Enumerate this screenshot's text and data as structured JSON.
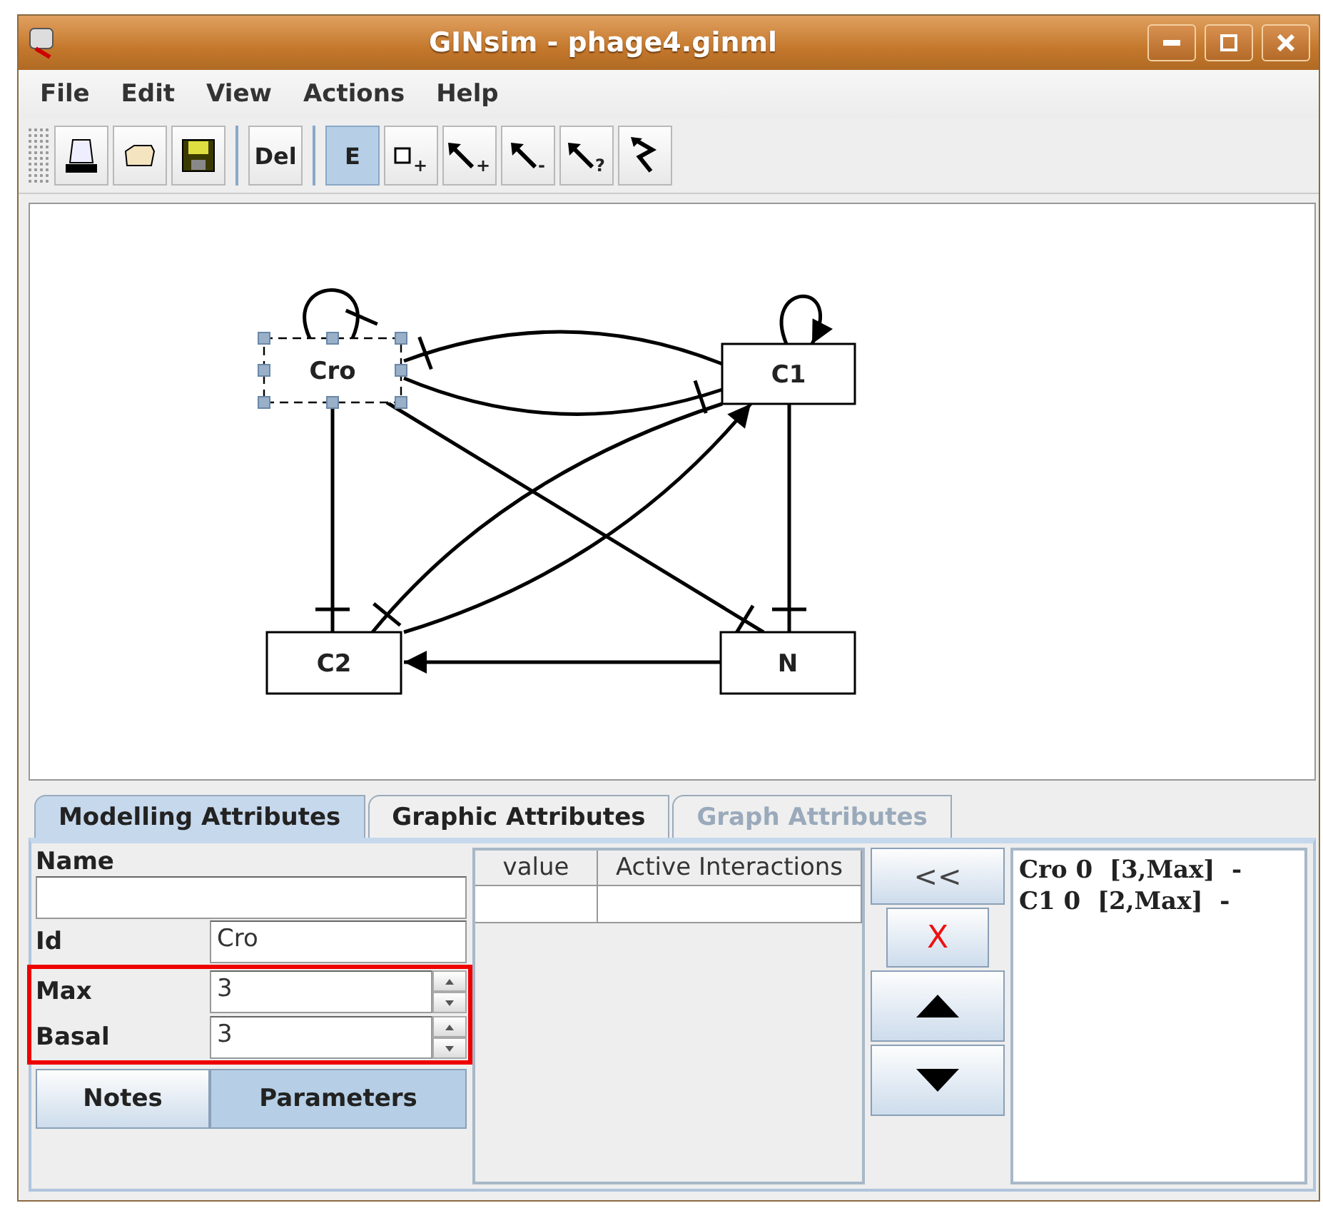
{
  "window": {
    "title": "GINsim - phage4.ginml"
  },
  "menu": [
    "File",
    "Edit",
    "View",
    "Actions",
    "Help"
  ],
  "toolbar": [
    {
      "kind": "print",
      "selected": false
    },
    {
      "kind": "open",
      "selected": false
    },
    {
      "kind": "save",
      "selected": false
    },
    {
      "kind": "text",
      "label": "Del",
      "selected": false
    },
    {
      "kind": "text",
      "label": "E",
      "selected": true
    },
    {
      "kind": "add-node",
      "sub": "+",
      "selected": false
    },
    {
      "kind": "arrow",
      "sub": "+",
      "selected": false
    },
    {
      "kind": "arrow",
      "sub": "-",
      "selected": false
    },
    {
      "kind": "arrow",
      "sub": "?",
      "selected": false
    },
    {
      "kind": "zigzag",
      "selected": false
    }
  ],
  "graph": {
    "nodes": [
      {
        "label": "Cro",
        "selected": true
      },
      {
        "label": "C1",
        "selected": false
      },
      {
        "label": "C2",
        "selected": false
      },
      {
        "label": "N",
        "selected": false
      }
    ],
    "edges": [
      {
        "kind": "inhibition"
      },
      {
        "kind": "activation"
      },
      {
        "kind": "inhibition"
      },
      {
        "kind": "inhibition"
      },
      {
        "kind": "inhibition"
      },
      {
        "kind": "inhibition"
      },
      {
        "kind": "inhibition"
      },
      {
        "kind": "activation"
      },
      {
        "kind": "inhibition"
      },
      {
        "kind": "activation"
      }
    ]
  },
  "panel": {
    "tabs": [
      {
        "label": "Modelling Attributes",
        "selected": true,
        "disabled": false
      },
      {
        "label": "Graphic Attributes",
        "selected": false,
        "disabled": false
      },
      {
        "label": "Graph Attributes",
        "selected": false,
        "disabled": true
      }
    ],
    "form": {
      "name_label": "Name",
      "id_label": "Id",
      "id_value": "Cro",
      "max_label": "Max",
      "max_value": "3",
      "basal_label": "Basal",
      "basal_value": "3",
      "highlight": true
    },
    "buttons": [
      {
        "label": "Notes",
        "selected": false
      },
      {
        "label": "Parameters",
        "selected": true
      }
    ],
    "table": {
      "columns": [
        "value",
        "Active Interactions"
      ]
    },
    "controls": [
      {
        "kind": "text",
        "label": "<<"
      },
      {
        "kind": "delete",
        "label": "X"
      },
      {
        "kind": "up"
      },
      {
        "kind": "down"
      }
    ],
    "list": [
      "Cro 0  [3,Max]  -",
      "C1 0  [2,Max]  -"
    ]
  }
}
